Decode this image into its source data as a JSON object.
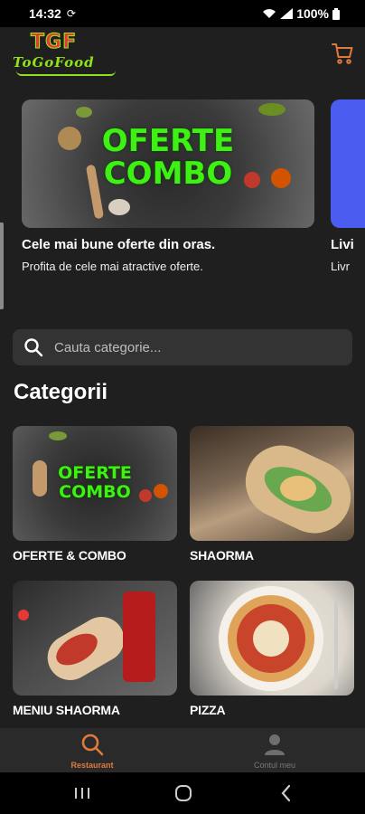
{
  "status_bar": {
    "time": "14:32",
    "battery": "100%"
  },
  "header": {
    "logo_text": "TGF",
    "logo_tagline": "ToGoFood"
  },
  "carousel": {
    "slides": [
      {
        "banner_line1": "OFERTE",
        "banner_line2": "COMBO",
        "title": "Cele mai bune oferte din oras.",
        "description": "Profita de cele mai atractive oferte."
      },
      {
        "title": "Livi",
        "description": "Livr"
      }
    ]
  },
  "search": {
    "placeholder": "Cauta categorie..."
  },
  "categories": {
    "title": "Categorii",
    "items": [
      {
        "label": "OFERTE & COMBO",
        "banner_line1": "OFERTE",
        "banner_line2": "COMBO"
      },
      {
        "label": "SHAORMA"
      },
      {
        "label": "MENIU SHAORMA"
      },
      {
        "label": "PIZZA"
      }
    ]
  },
  "bottom_nav": {
    "items": [
      {
        "label": "Restaurant",
        "icon": "search-icon",
        "active": true
      },
      {
        "label": "Contul meu",
        "icon": "person-icon",
        "active": false
      }
    ]
  },
  "colors": {
    "accent": "#e07a3c",
    "brand_green": "#3ef013",
    "background": "#1f1f1f"
  }
}
